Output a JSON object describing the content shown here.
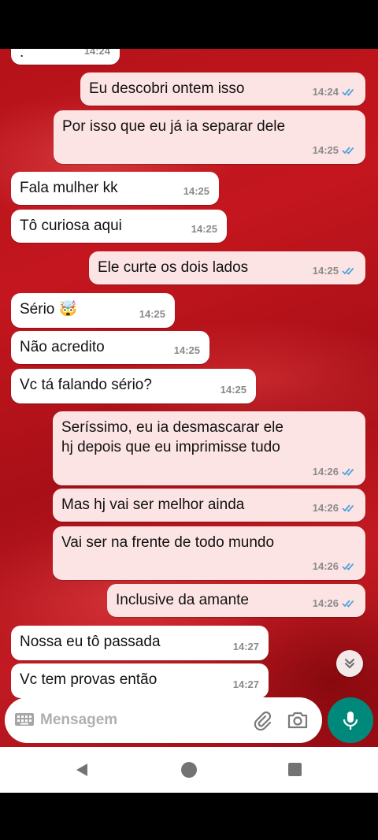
{
  "chat": {
    "messages": [
      {
        "dir": "in",
        "text": ".",
        "time": "14:24",
        "read": false
      },
      {
        "dir": "out",
        "text": "Eu descobri ontem isso",
        "time": "14:24",
        "read": true
      },
      {
        "dir": "out",
        "text": "Por isso que eu já ia separar dele",
        "time": "14:25",
        "read": true
      },
      {
        "dir": "in",
        "text": "Fala mulher kk",
        "time": "14:25",
        "read": false
      },
      {
        "dir": "in",
        "text": "Tô curiosa aqui",
        "time": "14:25",
        "read": false
      },
      {
        "dir": "out",
        "text": "Ele curte os dois lados",
        "time": "14:25",
        "read": true
      },
      {
        "dir": "in",
        "text": "Sério 🤯",
        "time": "14:25",
        "read": false
      },
      {
        "dir": "in",
        "text": "Não acredito",
        "time": "14:25",
        "read": false
      },
      {
        "dir": "in",
        "text": "Vc tá falando sério?",
        "time": "14:25",
        "read": false
      },
      {
        "dir": "out",
        "text": "Seríssimo, eu ia desmascarar ele\nhj depois que eu imprimisse tudo",
        "time": "14:26",
        "read": true
      },
      {
        "dir": "out",
        "text": "Mas hj vai ser melhor ainda",
        "time": "14:26",
        "read": true
      },
      {
        "dir": "out",
        "text": "Vai ser na frente de todo mundo",
        "time": "14:26",
        "read": true
      },
      {
        "dir": "out",
        "text": "Inclusive da amante",
        "time": "14:26",
        "read": true
      },
      {
        "dir": "in",
        "text": "Nossa eu tô passada",
        "time": "14:27",
        "read": false
      },
      {
        "dir": "in",
        "text": "Vc tem provas então",
        "time": "14:27",
        "read": false
      }
    ]
  },
  "composer": {
    "placeholder": "Mensagem",
    "keyboard_icon": "keyboard-icon",
    "attach_icon": "paperclip-icon",
    "camera_icon": "camera-icon",
    "mic_icon": "microphone-icon"
  },
  "scroll_down_icon": "double-chevron-down-icon",
  "colors": {
    "outgoing_bubble": "#fde4e4",
    "incoming_bubble": "#ffffff",
    "read_tick": "#4fa3e0",
    "mic_button": "#00897b",
    "wallpaper": "#b5121a"
  }
}
